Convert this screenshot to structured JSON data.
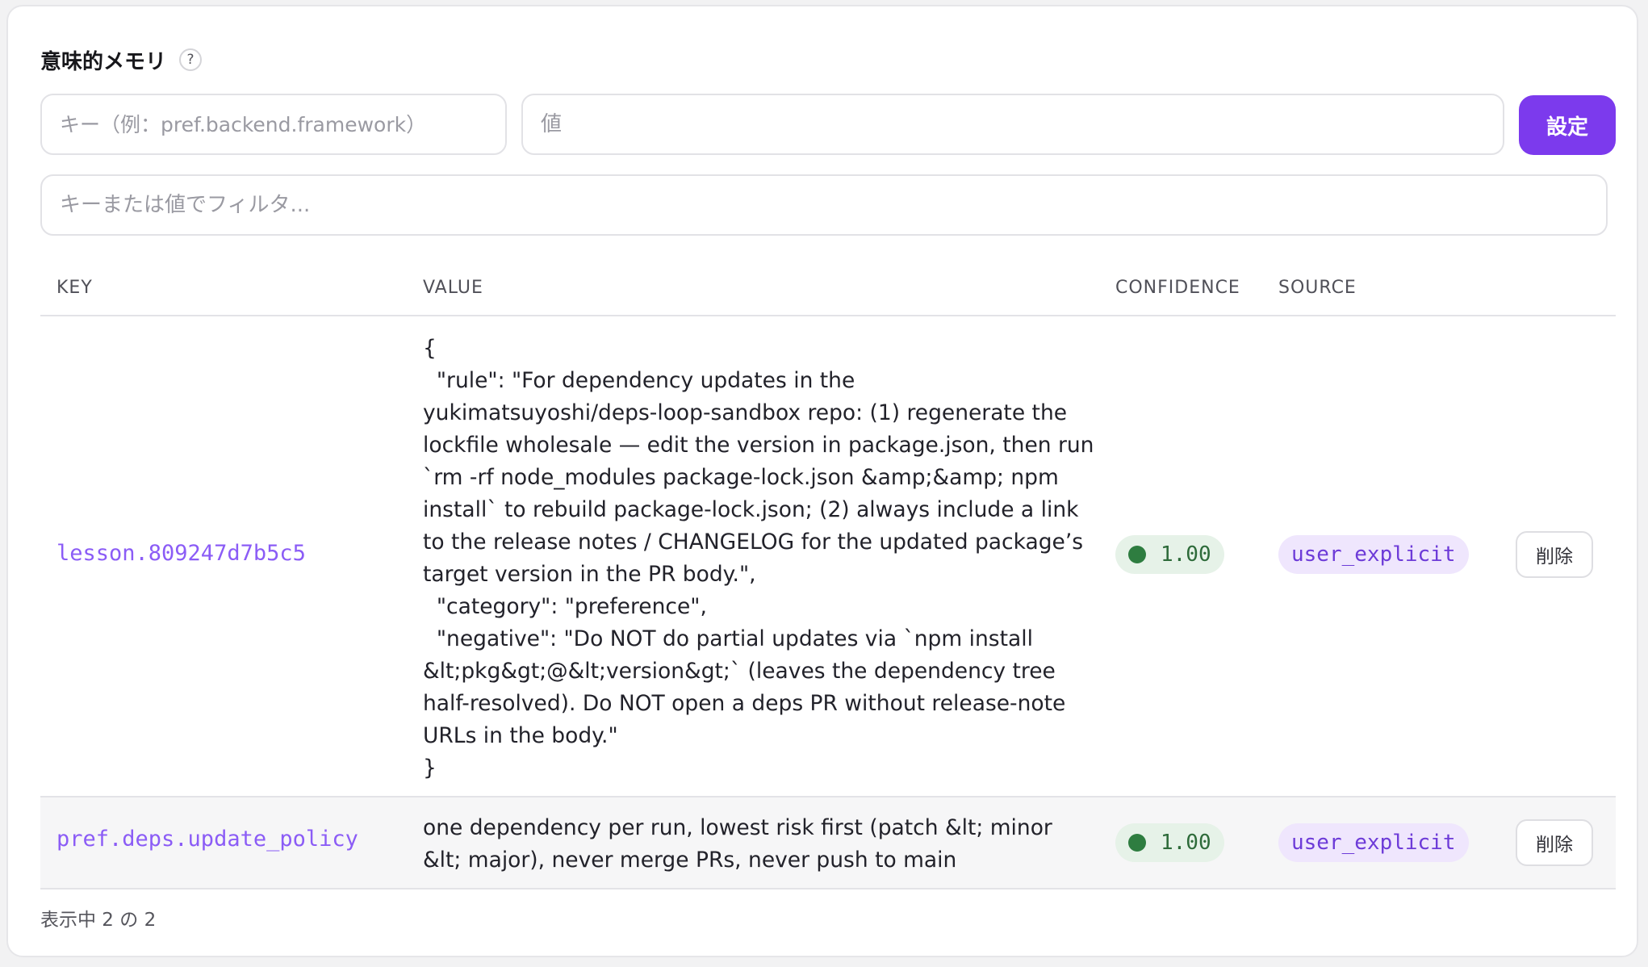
{
  "panel": {
    "title": "意味的メモリ",
    "help_symbol": "?"
  },
  "form": {
    "key_placeholder": "キー（例：pref.backend.framework）",
    "value_placeholder": "値",
    "set_label": "設定",
    "filter_placeholder": "キーまたは値でフィルタ..."
  },
  "table": {
    "headers": {
      "key": "KEY",
      "value": "VALUE",
      "confidence": "CONFIDENCE",
      "source": "SOURCE"
    },
    "rows": [
      {
        "key": "lesson.809247d7b5c5",
        "value": "{\n  \"rule\": \"For dependency updates in the yukimatsuyoshi/deps-loop-sandbox repo: (1) regenerate the lockfile wholesale — edit the version in package.json, then run `rm -rf node_modules package-lock.json &amp;&amp; npm install` to rebuild package-lock.json; (2) always include a link to the release notes / CHANGELOG for the updated package’s target version in the PR body.\",\n  \"category\": \"preference\",\n  \"negative\": \"Do NOT do partial updates via `npm install &lt;pkg&gt;@&lt;version&gt;` (leaves the dependency tree half-resolved). Do NOT open a deps PR without release-note URLs in the body.\"\n}",
        "confidence": "1.00",
        "source": "user_explicit",
        "delete_label": "削除"
      },
      {
        "key": "pref.deps.update_policy",
        "value": "one dependency per run, lowest risk first (patch &lt; minor &lt; major), never merge PRs, never push to main",
        "confidence": "1.00",
        "source": "user_explicit",
        "delete_label": "削除"
      }
    ]
  },
  "footer": {
    "count_text": "表示中 2 の 2"
  },
  "colors": {
    "accent": "#7c3aed",
    "key_text": "#8b5cf6",
    "confidence_dot": "#2e7d40",
    "confidence_bg": "#e6f2e8",
    "source_bg": "#efe6fd"
  },
  "icons": {
    "help": "help-icon",
    "confidence": "status-dot-icon"
  }
}
